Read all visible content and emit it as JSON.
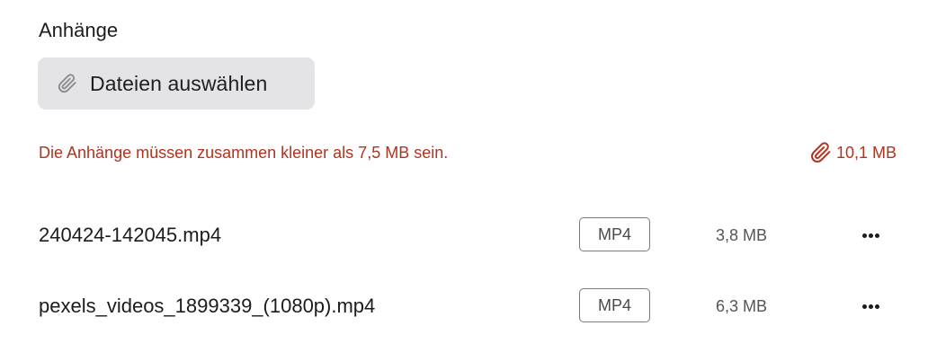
{
  "attachments": {
    "title": "Anhänge",
    "choose_button": {
      "label": "Dateien auswählen",
      "icon": "paperclip-icon"
    },
    "error_message": "Die Anhänge müssen zusammen kleiner als 7,5 MB sein.",
    "total_size": {
      "value": "10,1 MB",
      "icon": "paperclip-icon"
    },
    "error_color": "#b3321f",
    "files": [
      {
        "name": "240424-142045.mp4",
        "type": "MP4",
        "size": "3,8 MB",
        "menu_icon": "more-horizontal-icon"
      },
      {
        "name": "pexels_videos_1899339_(1080p).mp4",
        "type": "MP4",
        "size": "6,3 MB",
        "menu_icon": "more-horizontal-icon"
      }
    ]
  }
}
